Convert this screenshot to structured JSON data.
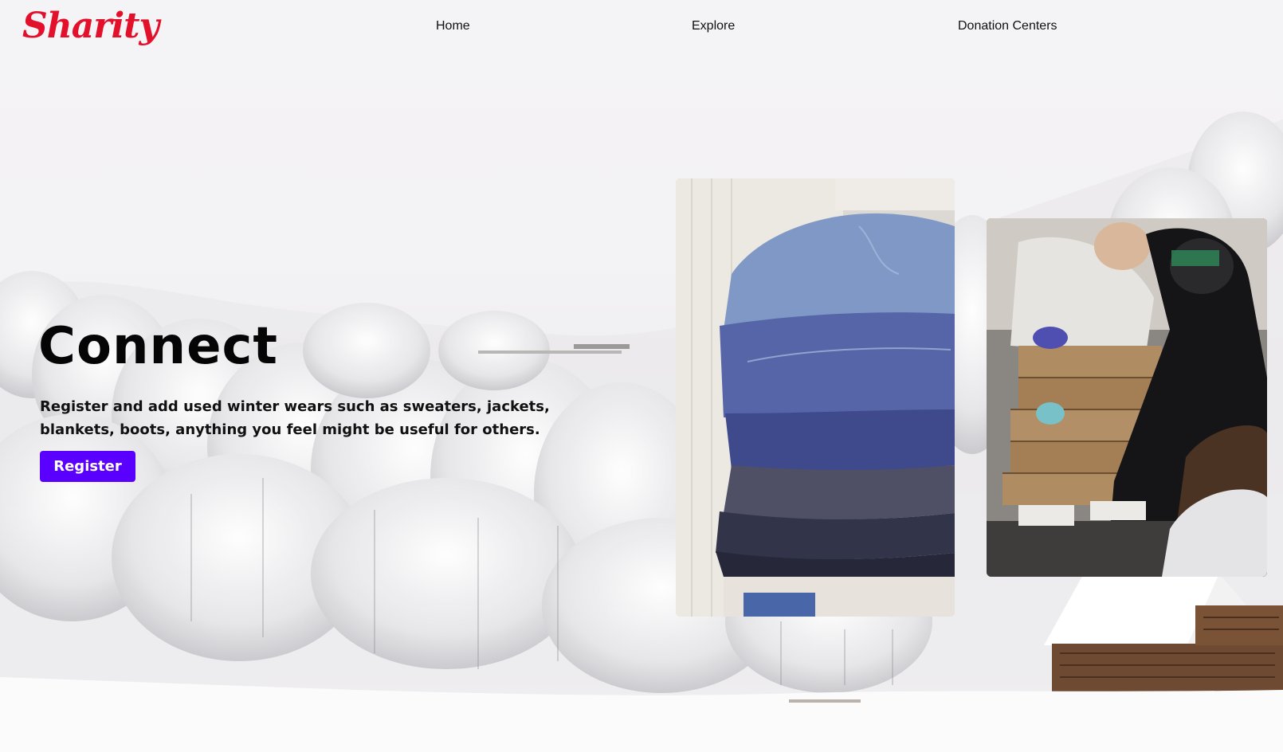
{
  "brand": {
    "logo_text": "Sharity",
    "accent_color": "#e2102b"
  },
  "nav": {
    "items": [
      {
        "label": "Home"
      },
      {
        "label": "Explore"
      },
      {
        "label": "Donation Centers"
      }
    ]
  },
  "hero": {
    "title": "Connect",
    "description": "Register and add used winter wears such as sweaters, jackets, blankets, boots, anything you feel might be useful for others.",
    "register_label": "Register",
    "button_color": "#5a00ff"
  },
  "images": {
    "background": "snowy-forest-with-cabin",
    "card_1": "stack-of-folded-jeans-photo",
    "card_2": "volunteers-handing-donation-boxes-photo"
  }
}
